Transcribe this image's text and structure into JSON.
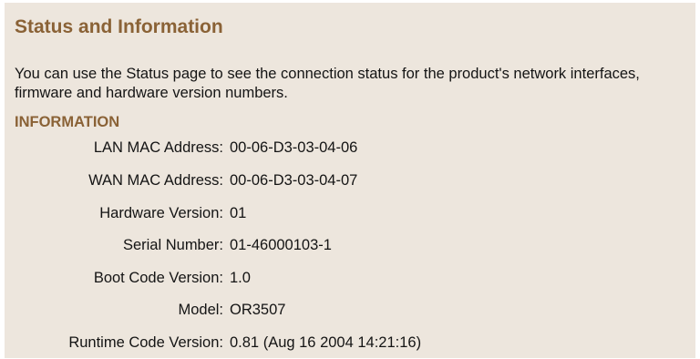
{
  "page": {
    "title": "Status and Information",
    "description": "You can use the Status page to see the connection status for the product's network interfaces, firmware and hardware version numbers."
  },
  "information": {
    "heading": "INFORMATION",
    "rows": [
      {
        "label": "LAN MAC Address:",
        "value": "00-06-D3-03-04-06"
      },
      {
        "label": "WAN MAC Address:",
        "value": "00-06-D3-03-04-07"
      },
      {
        "label": "Hardware Version:",
        "value": "01"
      },
      {
        "label": "Serial Number:",
        "value": "01-46000103-1"
      },
      {
        "label": "Boot Code Version:",
        "value": "1.0"
      },
      {
        "label": "Model:",
        "value": "OR3507"
      },
      {
        "label": "Runtime Code Version:",
        "value": "0.81 (Aug 16 2004 14:21:16)"
      }
    ]
  },
  "colors": {
    "background": "#ede6dd",
    "heading": "#8a6236",
    "text": "#141414"
  }
}
